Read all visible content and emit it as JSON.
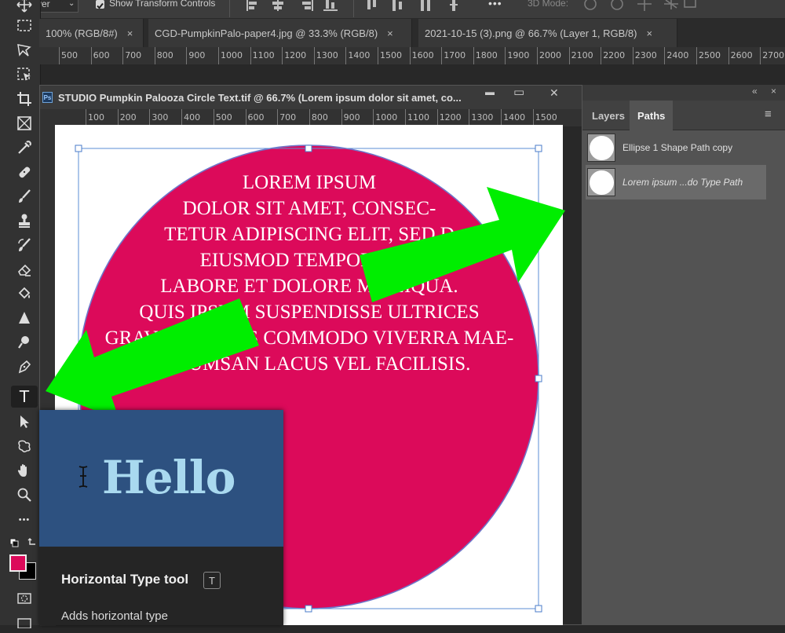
{
  "options_bar": {
    "partial_left": "ec",
    "layer_select": "yer",
    "show_transform_label": "Show Transform Controls",
    "mode_label": "3D Mode:"
  },
  "tabs": [
    {
      "label": "100% (RGB/8#)",
      "close": "×"
    },
    {
      "label": "CGD-PumpkinPalo-paper4.jpg @ 33.3% (RGB/8)",
      "close": "×"
    },
    {
      "label": "2021-10-15 (3).png @ 66.7% (Layer 1, RGB/8)",
      "close": "×"
    }
  ],
  "top_ruler_ticks": [
    "500",
    "600",
    "700",
    "800",
    "900",
    "1000",
    "1100",
    "1200",
    "1300",
    "1400",
    "1500",
    "1600",
    "1700",
    "1800",
    "1900",
    "2000",
    "2100",
    "2200",
    "2300",
    "2400",
    "2500",
    "2600",
    "2700"
  ],
  "document": {
    "ps_badge": "Ps",
    "title": "STUDIO Pumpkin Palooza Circle Text.tif @ 66.7% (Lorem ipsum dolor sit amet, co...",
    "ruler_ticks": [
      "100",
      "200",
      "300",
      "400",
      "500",
      "600",
      "700",
      "800",
      "900",
      "1000",
      "1100",
      "1200",
      "1300",
      "1400",
      "1500"
    ],
    "text_lines": [
      "LOREM IPSUM",
      "DOLOR SIT AMET, CONSEC-",
      "TETUR ADIPISCING ELIT, SED D",
      "EIUSMOD TEMPOR INCI",
      "LABORE ET DOLORE MA",
      "QUIS IPSUM SUSPENDISSE ULTRICES",
      "GRAVIDA. RISUS COMMODO VIVERRA MAE-",
      "ACCUMSAN LACUS VEL FACILISIS."
    ],
    "text_line_tail": "LIQUA.",
    "circle_color": "#dc0a5a"
  },
  "panel": {
    "collapse_glyph": "«",
    "close_glyph": "×",
    "tabs": [
      "Layers",
      "Paths"
    ],
    "active_tab": "Paths",
    "menu_glyph": "≡",
    "paths": [
      {
        "label": "Ellipse 1 Shape Path copy",
        "italic": false,
        "selected": false
      },
      {
        "label": "Lorem ipsum ...do Type Path",
        "italic": true,
        "selected": true
      }
    ]
  },
  "tooltip": {
    "preview_text": "Hello",
    "title": "Horizontal Type tool",
    "shortcut": "T",
    "description": "Adds horizontal type"
  },
  "toolbar": {
    "type_tool_glyph": "T",
    "more_glyph": "•••",
    "foreground_color": "#dc0a5a",
    "background_color": "#000000"
  },
  "window_controls": {
    "minimize": "▬",
    "maximize": "▭",
    "close": "✕"
  },
  "arrow_color": "#00ee00"
}
